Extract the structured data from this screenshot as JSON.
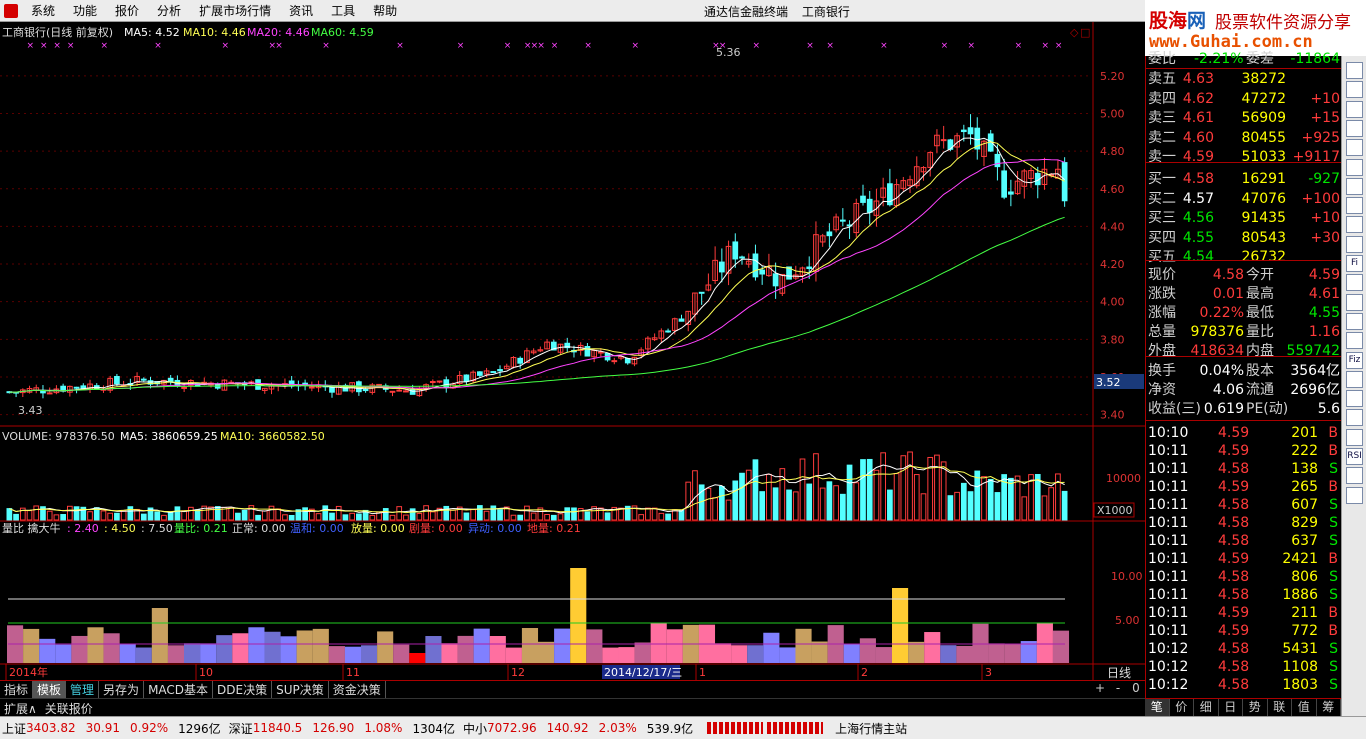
{
  "menu": {
    "items": [
      "系统",
      "功能",
      "报价",
      "分析",
      "扩展市场行情",
      "资讯",
      "工具",
      "帮助"
    ],
    "center_title": [
      "通达信金融终端",
      "工商银行"
    ]
  },
  "brand": {
    "part1": "股海",
    "part2": "网",
    "slogan": "股票软件资源分享",
    "url": "www.Guhai.com.cn"
  },
  "kline": {
    "header": {
      "name": "工商银行(日线 前复权)",
      "ma5": "MA5: 4.52",
      "ma10": "MA10: 4.46",
      "ma20": "MA20: 4.46",
      "ma60": "MA60: 4.59"
    },
    "y_ticks": [
      "5.20",
      "5.00",
      "4.80",
      "4.60",
      "4.40",
      "4.20",
      "4.00",
      "3.80",
      "3.60",
      "3.40"
    ],
    "y_range": [
      3.35,
      5.38
    ],
    "current_price_tag": "3.52",
    "high_label": "5.36",
    "low_label": "3.43",
    "colors": {
      "up": "#ff3c3c",
      "down": "#54ffff",
      "ma5": "#ffffff",
      "ma10": "#ffff55",
      "ma20": "#ff44ff",
      "ma60": "#44ff44"
    }
  },
  "volume": {
    "header": {
      "label": "VOLUME: 978376.50",
      "ma5": "MA5: 3860659.25",
      "ma10": "MA10: 3660582.50"
    },
    "y_tick": "10000",
    "unit": "X1000"
  },
  "indicator": {
    "header": {
      "title": "量比 擒大牛",
      "v1": ": 2.40",
      "v2": ": 4.50",
      "v3": ": 7.50",
      "lb": "量比: 0.21",
      "nm": "正常: 0.00",
      "wh": "温和: 0.00",
      "fl": "放量: 0.00",
      "jl": "剧量: 0.00",
      "yd": "异动: 0.00",
      "dl": "地量: 0.21"
    },
    "y_ticks": [
      "10.00",
      "5.00"
    ]
  },
  "xaxis": {
    "labels": [
      "2014年",
      "10",
      "11",
      "12",
      "1",
      "2",
      "3"
    ],
    "cursor_date": "2014/12/17/三",
    "period": "日线"
  },
  "tabs": [
    "指标",
    "模板",
    "管理",
    "另存为",
    "MACD基本",
    "DDE决策",
    "SUP决策",
    "资金决策"
  ],
  "tab_controls": [
    "+",
    "-",
    "0"
  ],
  "ext_tabs": [
    "扩展∧",
    "关联报价"
  ],
  "side": {
    "top_row": {
      "label1": "委比",
      "v1": "-2.21%",
      "label2": "委差",
      "v2": "-11864"
    },
    "asks": [
      {
        "label": "卖五",
        "price": "4.63",
        "vol": "38272",
        "chg": ""
      },
      {
        "label": "卖四",
        "price": "4.62",
        "vol": "47272",
        "chg": "+10"
      },
      {
        "label": "卖三",
        "price": "4.61",
        "vol": "56909",
        "chg": "+15"
      },
      {
        "label": "卖二",
        "price": "4.60",
        "vol": "80455",
        "chg": "+925"
      },
      {
        "label": "卖一",
        "price": "4.59",
        "vol": "51033",
        "chg": "+9117"
      }
    ],
    "bids": [
      {
        "label": "买一",
        "price": "4.58",
        "vol": "16291",
        "chg": "-927"
      },
      {
        "label": "买二",
        "price": "4.57",
        "vol": "47076",
        "chg": "+100"
      },
      {
        "label": "买三",
        "price": "4.56",
        "vol": "91435",
        "chg": "+10"
      },
      {
        "label": "买四",
        "price": "4.55",
        "vol": "80543",
        "chg": "+30"
      },
      {
        "label": "买五",
        "price": "4.54",
        "vol": "26732",
        "chg": ""
      }
    ],
    "stats": [
      {
        "l1": "现价",
        "v1": "4.58",
        "l2": "今开",
        "v2": "4.59"
      },
      {
        "l1": "涨跌",
        "v1": "0.01",
        "l2": "最高",
        "v2": "4.61"
      },
      {
        "l1": "涨幅",
        "v1": "0.22%",
        "l2": "最低",
        "v2": "4.55"
      },
      {
        "l1": "总量",
        "v1": "978376",
        "l2": "量比",
        "v2": "1.16"
      },
      {
        "l1": "外盘",
        "v1": "418634",
        "l2": "内盘",
        "v2": "559742"
      }
    ],
    "stats2": [
      {
        "l1": "换手",
        "v1": "0.04%",
        "l2": "股本",
        "v2": "3564亿"
      },
      {
        "l1": "净资",
        "v1": "4.06",
        "l2": "流通",
        "v2": "2696亿"
      },
      {
        "l1": "收益(三)",
        "v1": "0.619",
        "l2": "PE(动)",
        "v2": "5.6"
      }
    ],
    "ticks": [
      {
        "t": "10:10",
        "p": "4.59",
        "v": "201",
        "bs": "B"
      },
      {
        "t": "10:11",
        "p": "4.59",
        "v": "222",
        "bs": "B"
      },
      {
        "t": "10:11",
        "p": "4.58",
        "v": "138",
        "bs": "S"
      },
      {
        "t": "10:11",
        "p": "4.59",
        "v": "265",
        "bs": "B"
      },
      {
        "t": "10:11",
        "p": "4.58",
        "v": "607",
        "bs": "S"
      },
      {
        "t": "10:11",
        "p": "4.58",
        "v": "829",
        "bs": "S"
      },
      {
        "t": "10:11",
        "p": "4.58",
        "v": "637",
        "bs": "S"
      },
      {
        "t": "10:11",
        "p": "4.59",
        "v": "2421",
        "bs": "B"
      },
      {
        "t": "10:11",
        "p": "4.58",
        "v": "806",
        "bs": "S"
      },
      {
        "t": "10:11",
        "p": "4.58",
        "v": "1886",
        "bs": "S"
      },
      {
        "t": "10:11",
        "p": "4.59",
        "v": "211",
        "bs": "B"
      },
      {
        "t": "10:11",
        "p": "4.59",
        "v": "772",
        "bs": "B"
      },
      {
        "t": "10:12",
        "p": "4.58",
        "v": "5431",
        "bs": "S"
      },
      {
        "t": "10:12",
        "p": "4.58",
        "v": "1108",
        "bs": "S"
      },
      {
        "t": "10:12",
        "p": "4.58",
        "v": "1803",
        "bs": "S"
      }
    ],
    "bottom_tabs": [
      "笔",
      "价",
      "细",
      "日",
      "势",
      "联",
      "值",
      "筹"
    ]
  },
  "toolstrip": [
    "",
    "",
    "",
    "",
    "",
    "",
    "",
    "",
    "",
    "",
    "Fi",
    "",
    "",
    "",
    "",
    "Fiz",
    "",
    "",
    "",
    "",
    "RSI",
    "",
    ""
  ],
  "status": {
    "sh_label": "上证",
    "sh_val": "3403.82",
    "sh_chg": "30.91",
    "sh_pct": "0.92%",
    "sh_amt": "1296亿",
    "sz_label": "深证",
    "sz_val": "11840.5",
    "sz_chg": "126.90",
    "sz_pct": "1.08%",
    "sz_amt": "1304亿",
    "zx_label": "中小",
    "zx_val": "7072.96",
    "zx_chg": "140.92",
    "zx_pct": "2.03%",
    "zx_amt": "539.9亿",
    "server": "上海行情主站"
  }
}
